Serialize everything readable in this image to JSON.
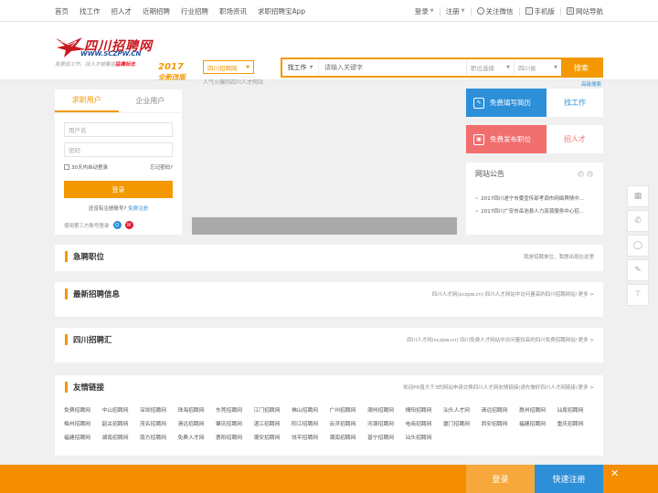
{
  "topnav": {
    "items": [
      "首页",
      "找工作",
      "招人才",
      "近期招聘",
      "行业招聘",
      "职场资讯",
      "求职招聘宝App"
    ],
    "login": "登录",
    "register": "注册",
    "wechat": "关注微信",
    "mobile": "手机版",
    "sitenav": "网站导航"
  },
  "logo": {
    "name": "四川招聘网",
    "domain": "WWW.SCZPW.CN",
    "tagline_pre": "免费找工作、找人才就看这",
    "tagline_hl": "猛鹰标志",
    "year": "2017",
    "edition": "全新改版"
  },
  "site": {
    "selector": "四川招聘网",
    "tagline": "人气火爆的四川人才网站"
  },
  "search": {
    "type": "找工作",
    "placeholder": "请输入关键字",
    "position": "职位选择",
    "region": "四川省",
    "button": "搜索",
    "advanced": "高级搜索"
  },
  "login": {
    "tab_seeker": "求职用户",
    "tab_company": "企业用户",
    "username_placeholder": "用户名",
    "password_placeholder": "密码",
    "remember": "30天内自动登录",
    "forgot": "忘记密码?",
    "button": "登录",
    "no_account": "还没有注册账号?",
    "register_link": "免费注册",
    "third_party": "使用第三方账号登录"
  },
  "quick": {
    "resume": "免费填写简历",
    "find_job": "找工作",
    "post_job": "免费发布职位",
    "find_talent": "招人才"
  },
  "notice": {
    "title": "网站公告",
    "items": [
      "2017四川遂宁市委宣传部考调市网络舆情中...",
      "2017四川广安市岳池县人力资源服务中心招..."
    ]
  },
  "sections": {
    "urgent": {
      "title": "急聘职位",
      "note": "我是招聘单位，我想出现在这里"
    },
    "latest": {
      "title": "最新招聘信息",
      "note": "四川人才网(sczpw.cn) 四川人才网站中访问量高的四川招聘网站!",
      "more": "更多 >"
    },
    "hub": {
      "title": "四川招聘汇",
      "note": "四川人才网(sczpw.cn) 四川免费人才网站中访问量较高的四川免费招聘网站!",
      "more": "更多 >"
    },
    "friends": {
      "title": "友情链接",
      "note": "欢迎PR值大于3的网站申请交换四川人才网友情链接(请先做好四川人才网链接)",
      "more": "更多 >",
      "links": [
        "免费招聘网",
        "中山招聘网",
        "深圳招聘网",
        "珠海招聘网",
        "东莞招聘网",
        "江门招聘网",
        "佛山招聘网",
        "广州招聘网",
        "潮州招聘网",
        "揭阳招聘网",
        "汕头人才网",
        "清远招聘网",
        "惠州招聘网",
        "汕尾招聘网",
        "梅州招聘网",
        "韶关招聘网",
        "茂名招聘网",
        "清远招聘网",
        "肇庆招聘网",
        "湛江招聘网",
        "阳江招聘网",
        "云浮招聘网",
        "河源招聘网",
        "电商招聘网",
        "厦门招聘网",
        "西安招聘网",
        "福建招聘网",
        "重庆招聘网",
        "福建招聘网",
        "湖南招聘网",
        "南方招聘网",
        "免费人才网",
        "惠阳招聘网",
        "潮安招聘网",
        "饶平招聘网",
        "潮南招聘网",
        "普宁招聘网",
        "汕头招聘网"
      ]
    }
  },
  "bottom": {
    "login": "登录",
    "register": "快速注册",
    "close": "✕"
  },
  "colors": {
    "orange": "#f39800",
    "blue": "#2d8fd8",
    "red": "#f06e6e"
  }
}
